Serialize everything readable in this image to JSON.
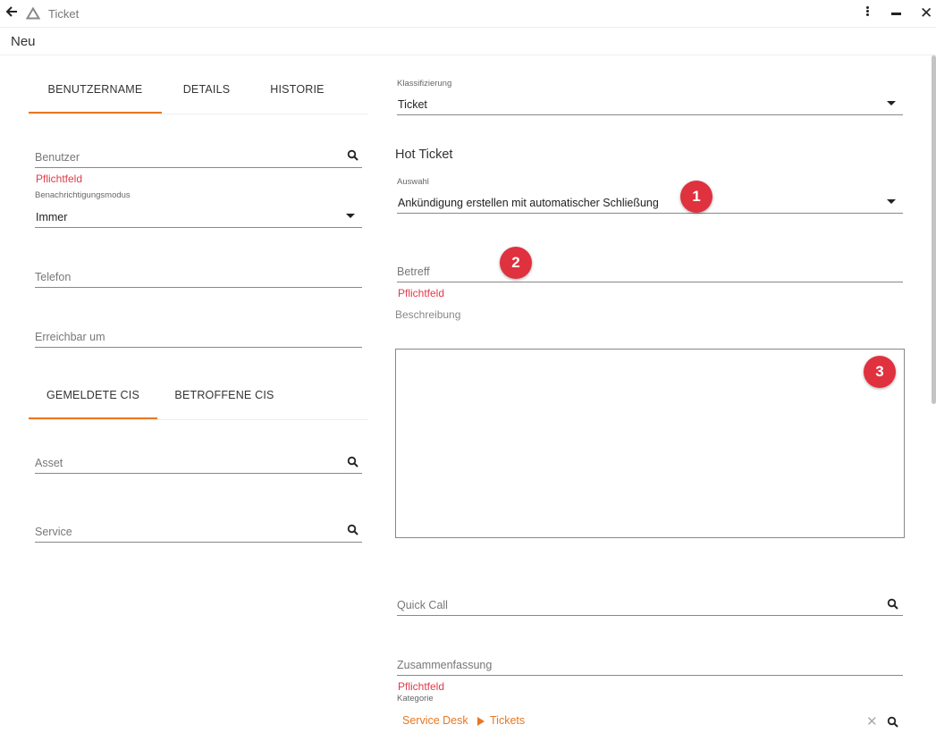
{
  "window": {
    "title": "Ticket",
    "record_label": "Neu"
  },
  "left_tabs": [
    {
      "label": "BENUTZERNAME"
    },
    {
      "label": "DETAILS"
    },
    {
      "label": "HISTORIE"
    }
  ],
  "user_section": {
    "benutzer_label": "Benutzer",
    "benutzer_required": "Pflichtfeld",
    "notify_label": "Benachrichtigungsmodus",
    "notify_value": "Immer",
    "telefon_label": "Telefon",
    "erreichbar_label": "Erreichbar um"
  },
  "ci_tabs": [
    {
      "label": "GEMELDETE CIS"
    },
    {
      "label": "BETROFFENE CIS"
    }
  ],
  "ci_section": {
    "asset_label": "Asset",
    "service_label": "Service"
  },
  "right": {
    "klassifizierung_label": "Klassifizierung",
    "klassifizierung_value": "Ticket",
    "hot_ticket_heading": "Hot Ticket",
    "auswahl_label": "Auswahl",
    "auswahl_value": "Ankündigung erstellen mit automatischer Schließung",
    "betreff_label": "Betreff",
    "betreff_required": "Pflichtfeld",
    "beschreibung_label": "Beschreibung",
    "quick_call_label": "Quick Call",
    "zusammenfassung_label": "Zusammenfassung",
    "zusammenfassung_required": "Pflichtfeld",
    "kategorie_label": "Kategorie",
    "kategorie_path": [
      "Service Desk",
      "Tickets"
    ]
  },
  "badges": [
    "1",
    "2",
    "3"
  ],
  "colors": {
    "accent": "#e87722",
    "required": "#e3394a",
    "badge": "#e0313e"
  }
}
